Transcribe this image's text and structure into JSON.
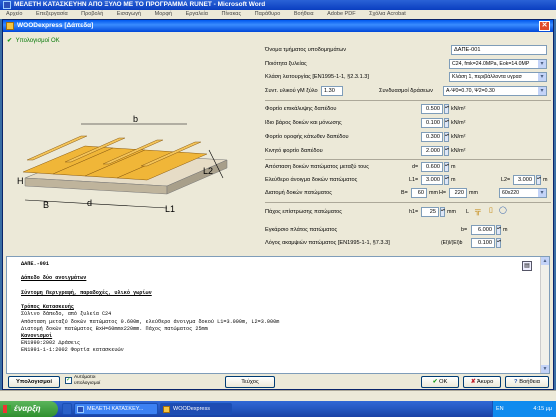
{
  "word_window": {
    "title": "ΜΕΛΕΤΗ ΚΑΤΑΣΚΕΥΗΝ ΑΠΟ ΞΥΛΟ ΜΕ ΤΟ ΠΡΟΓΡΑΜΜΑ RUNET - Microsoft Word",
    "menu": [
      "Αρχείο",
      "Επεξεργασία",
      "Προβολή",
      "Εισαγωγή",
      "Μορφή",
      "Εργαλεία",
      "Πίνακας",
      "Παράθυρο",
      "Βοήθεια",
      "Adobe PDF",
      "Σχόλια Acrobat"
    ]
  },
  "dialog": {
    "title": "WOODexpress   [Δάπεδα]",
    "close_glyph": "✕",
    "check_status": "Υπολογισμοί ΟΚ"
  },
  "diagram_labels": {
    "b": "b",
    "L2": "L2",
    "H": "H",
    "B": "B",
    "d": "d",
    "L1": "L1"
  },
  "form": {
    "element_name_label": "Όνομα τμήματος υποδομημάτων",
    "element_name_value": "ΔΑΠΕ-001",
    "quality_label": "Ποιότητα ξυλείας",
    "quality_value": "C24, fmk=24.0MPa, Eok=14.0MP",
    "service_class_label": "Κλάση λειτουργίας [EN1995-1-1, §2.3.1.3]",
    "service_class_value": "Κλάση 1, περιβάλλοντα υγρασ",
    "gamma_label": "Συντ. υλικού γM ξύλο",
    "gamma_value": "1.30",
    "combination_label": "Συνδυασμοί δράσεων",
    "combination_value": "A-Ψ0=0.70, Ψ2=0.30",
    "floor_finish_label": "Φορτίο επικάλυψης δαπέδου",
    "floor_finish_value": "0.500",
    "self_weight_label": "Ιδιο βάρος δοκών και μόνωσης",
    "self_weight_value": "0.100",
    "ceiling_load_label": "Φορτίο οροφής κάτωθεν δαπέδου",
    "ceiling_load_value": "0.300",
    "live_load_label": "Κινητό φορτίο δαπέδου",
    "live_load_value": "2.000",
    "load_unit": "kN/m²",
    "spacing_label": "Απόσταση δοκών πατώματος μεταξύ τους",
    "spacing_symbol": "d=",
    "spacing_value": "0.600",
    "spacing_unit": "m",
    "spans_label": "Ελεύθερο άνοιγμα δοκών πατώματος",
    "L1_symbol": "L1=",
    "L1_value": "3.000",
    "L2_symbol": "L2=",
    "L2_value": "3.000",
    "span_unit": "m",
    "section_label": "Διατομή δοκών πατώματος",
    "B_symbol": "B=",
    "B_value": "60",
    "mm1": "mm",
    "H_symbol": "H=",
    "H_value": "220",
    "mm2": "mm",
    "section_preset": "60x220",
    "plank_label": "Πάχος επίστρωσης πατώματος",
    "plank_symbol": "h1=",
    "plank_value": "25",
    "plank_unit": "mm",
    "plank_L": "L",
    "width_label": "Εγκάρσιο πλάτος πατώματος",
    "width_symbol": "b=",
    "width_value": "6.000",
    "width_unit": "m",
    "deflection_label": "Λόγος ακαμψιών πατώματος [EN1995-1-1, §7.3.3]",
    "deflection_symbol": "(EI)l/(EI)b",
    "deflection_value": "0.100"
  },
  "report": {
    "lines": [
      "ΔΑΠΕ.-001",
      "",
      "Δάπεδο δύο ανοιγμάτων",
      "",
      "Σύντομη Περιγραφή, παραδοχές, υλικό γωρίων",
      "",
      "Τρόπος Κατασκευής",
      "Σύλινο δάπεδο, από ξυλεία C24",
      "Απόσταση μεταξύ δοκών πατώματος 0.600m, ελεύθερο άνοιγμα δοκού L1=3.000m, L2=3.000m",
      "Διατομή δοκών πατώματος BxH=60mmx220mm. Πάχος πατώματος 25mm",
      "Κανονισμοί",
      "EN1990:2002 Δράσεις",
      "EN1991-1-1:2002 Φορτία κατασκευών"
    ],
    "print_glyph": "▤"
  },
  "bottom_bar": {
    "calc_button": "Υπολογισμοί",
    "auto_calc_label": "Αυτόματοι υπολογισμοί",
    "report_button": "Τεύχος",
    "ok_button": "OK",
    "cancel_button": "Άκυρο",
    "help_button": "Βοήθεια"
  },
  "taskbar": {
    "start": "έναρξη",
    "tasks": [
      "",
      "ΜΕΛΕΤΗ ΚΑΤΑΣΚΕΥ...",
      "WOODexpress"
    ],
    "lang": "EN",
    "clock": "4:15 μμ"
  },
  "colors": {
    "title_blue": "#0058ee",
    "desktop": "#3a6ea5",
    "ok_green": "#1a9c1a",
    "wood": "#f0b638"
  }
}
